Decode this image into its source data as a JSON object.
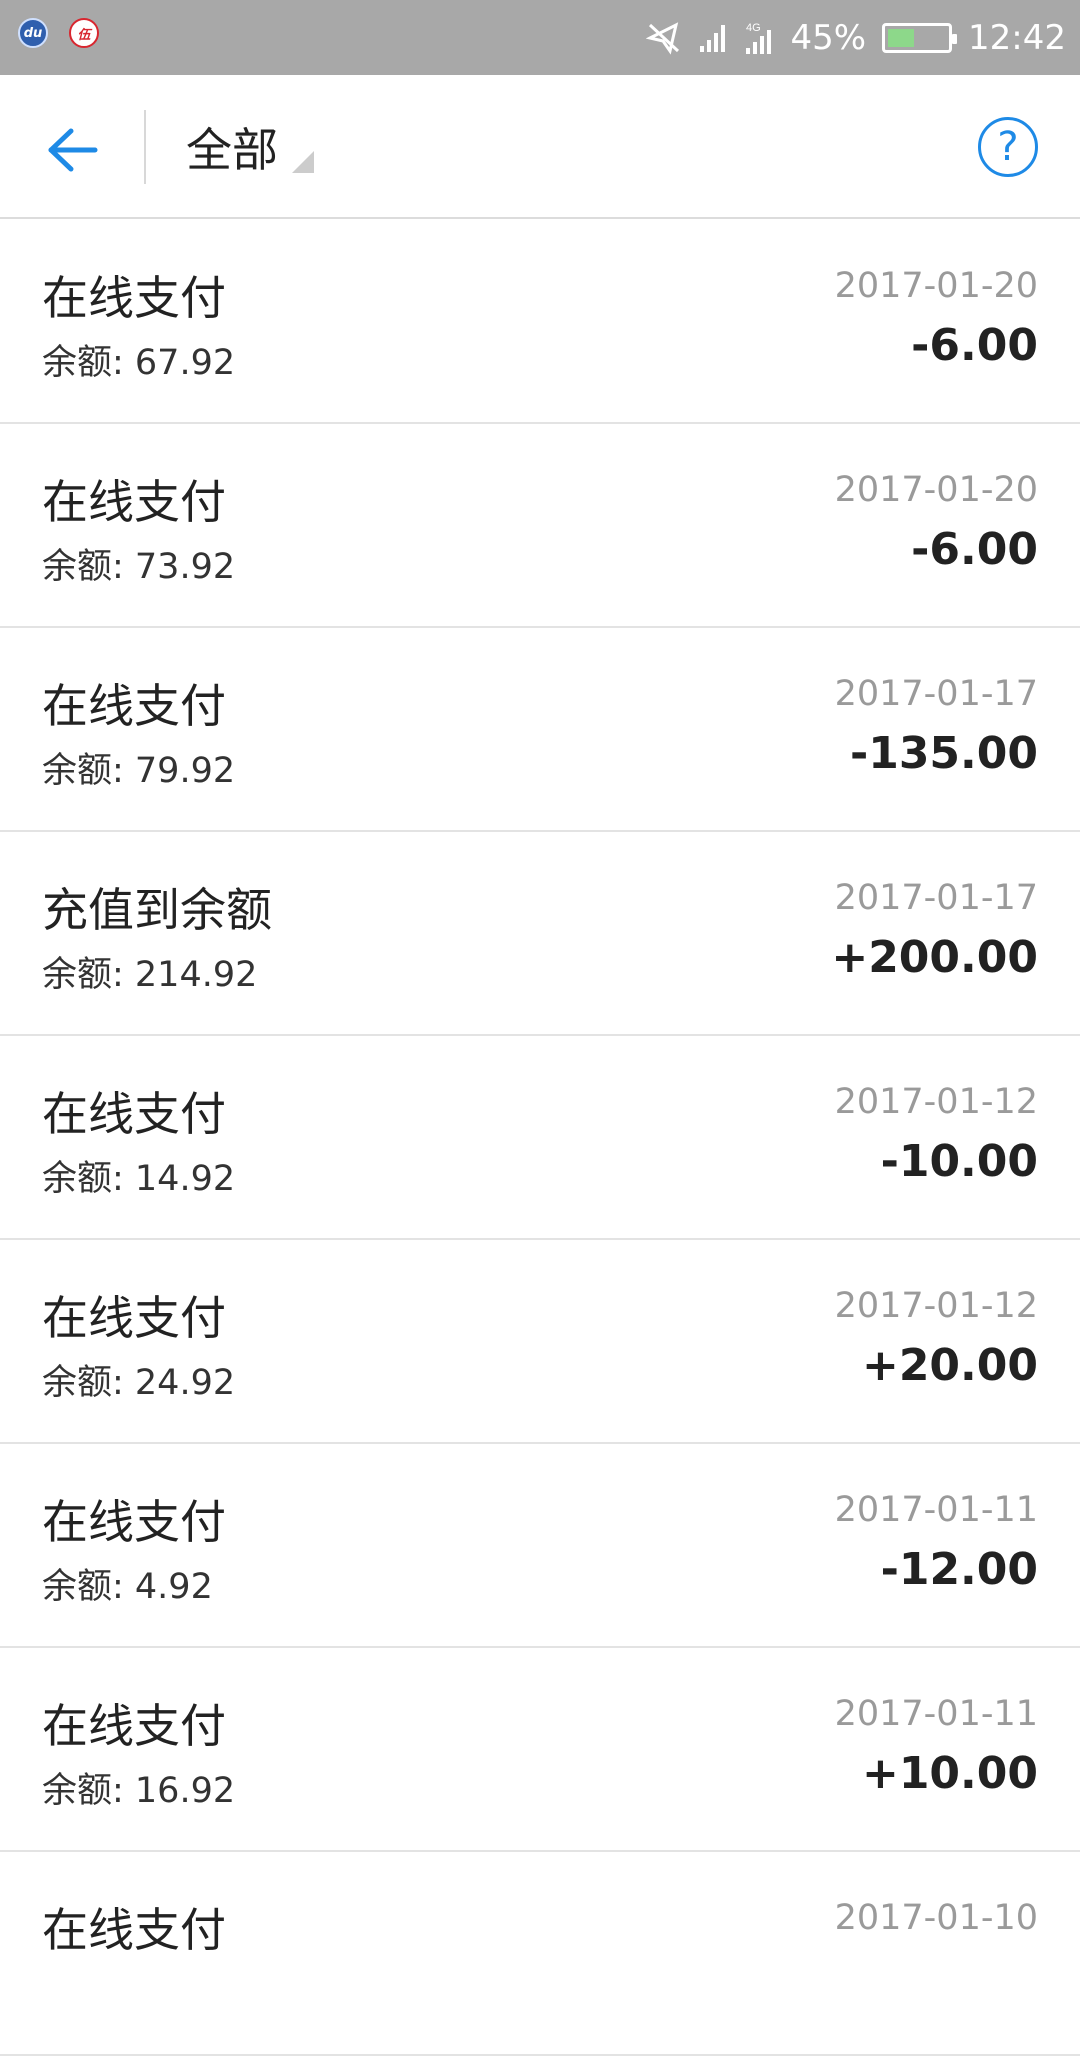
{
  "status_bar": {
    "app_icon_1": "du",
    "app_icon_2": "伍",
    "network": "4G",
    "battery_percent": "45%",
    "battery_level": 0.45,
    "time": "12:42"
  },
  "header": {
    "filter_label": "全部",
    "back_icon": "arrow-left-icon",
    "help_icon": "question-circle-icon",
    "help_glyph": "?",
    "accent_color": "#1e8ae6"
  },
  "transactions": [
    {
      "title": "在线支付",
      "balance": "余额: 67.92",
      "date": "2017-01-20",
      "amount": "-6.00"
    },
    {
      "title": "在线支付",
      "balance": "余额: 73.92",
      "date": "2017-01-20",
      "amount": "-6.00"
    },
    {
      "title": "在线支付",
      "balance": "余额: 79.92",
      "date": "2017-01-17",
      "amount": "-135.00"
    },
    {
      "title": "充值到余额",
      "balance": "余额: 214.92",
      "date": "2017-01-17",
      "amount": "+200.00"
    },
    {
      "title": "在线支付",
      "balance": "余额: 14.92",
      "date": "2017-01-12",
      "amount": "-10.00"
    },
    {
      "title": "在线支付",
      "balance": "余额: 24.92",
      "date": "2017-01-12",
      "amount": "+20.00"
    },
    {
      "title": "在线支付",
      "balance": "余额: 4.92",
      "date": "2017-01-11",
      "amount": "-12.00"
    },
    {
      "title": "在线支付",
      "balance": "余额: 16.92",
      "date": "2017-01-11",
      "amount": "+10.00"
    },
    {
      "title": "在线支付",
      "balance": "",
      "date": "2017-01-10",
      "amount": ""
    }
  ]
}
